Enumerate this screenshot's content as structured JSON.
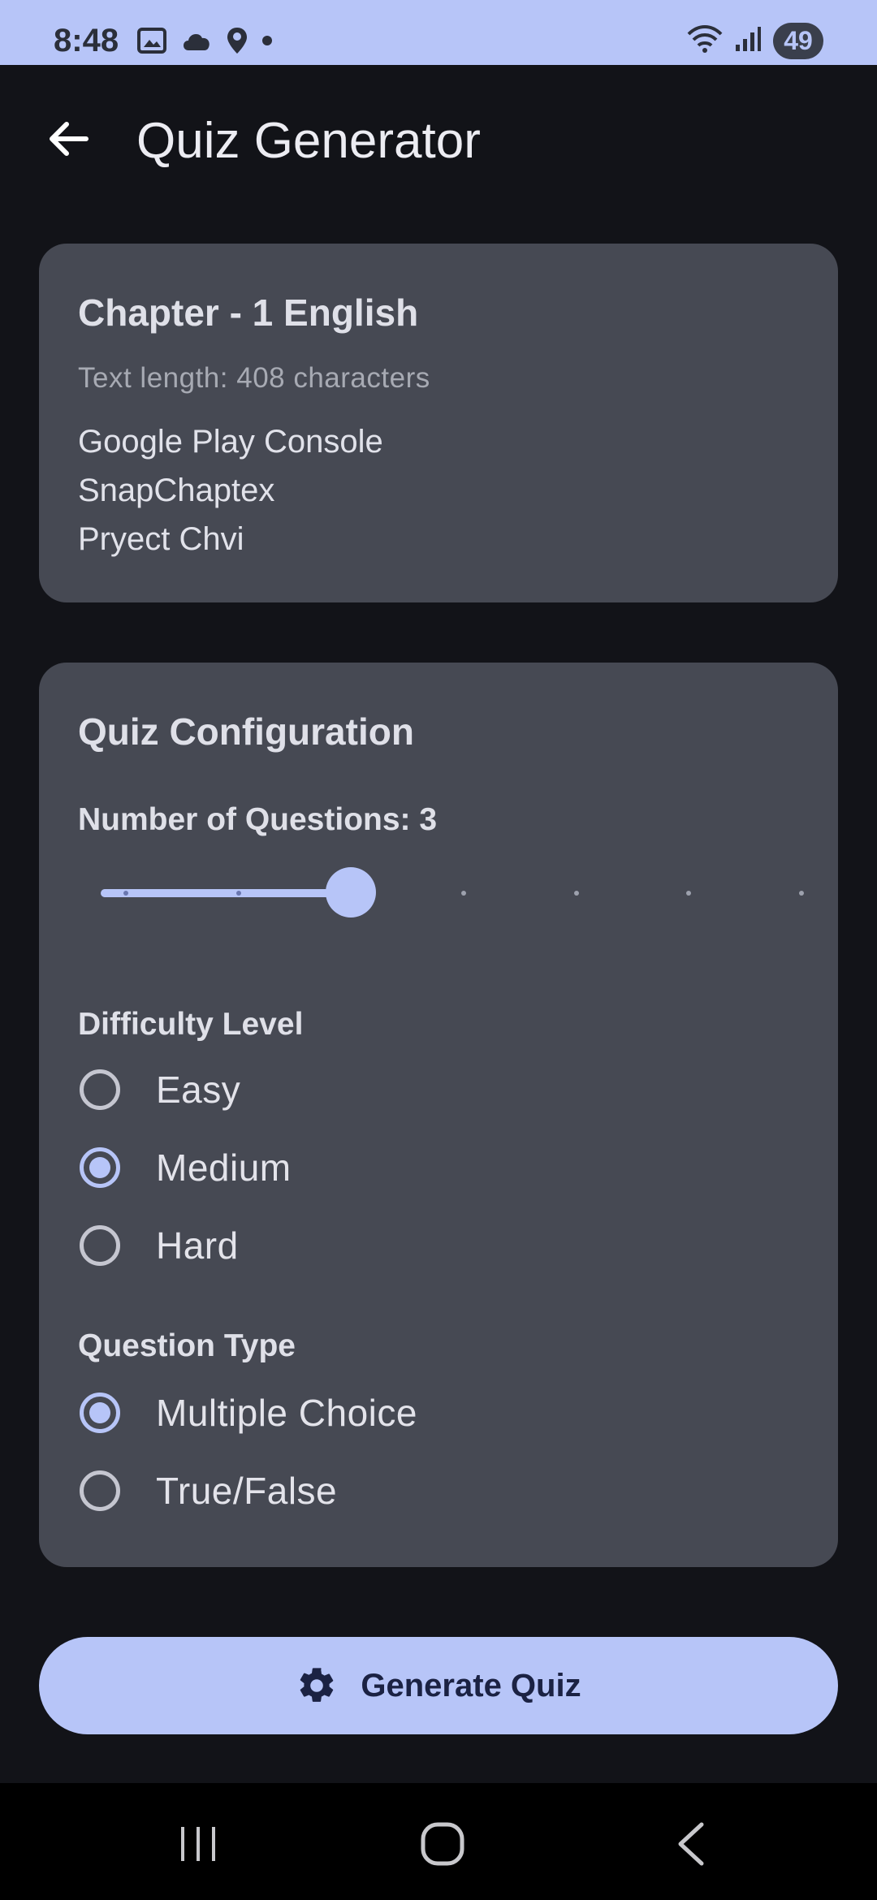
{
  "status_bar": {
    "time": "8:48",
    "battery": "49"
  },
  "app_bar": {
    "title": "Quiz Generator"
  },
  "chapter_card": {
    "title": "Chapter - 1 English",
    "text_length": "Text length: 408 characters",
    "lines": [
      "Google Play Console",
      "SnapChaptex",
      "Pryect Chvi"
    ]
  },
  "config": {
    "title": "Quiz Configuration",
    "num_questions_label": "Number of Questions: 3",
    "slider": {
      "value": 3,
      "min": 1,
      "max": 7
    },
    "difficulty_label": "Difficulty Level",
    "difficulty_options": [
      {
        "label": "Easy",
        "checked": false
      },
      {
        "label": "Medium",
        "checked": true
      },
      {
        "label": "Hard",
        "checked": false
      }
    ],
    "type_label": "Question Type",
    "type_options": [
      {
        "label": "Multiple Choice",
        "checked": true
      },
      {
        "label": "True/False",
        "checked": false
      }
    ]
  },
  "generate_button": {
    "label": "Generate Quiz",
    "icon": "gear-icon"
  },
  "colors": {
    "accent": "#b7c5f8",
    "background": "#121318",
    "card": "#464953"
  }
}
